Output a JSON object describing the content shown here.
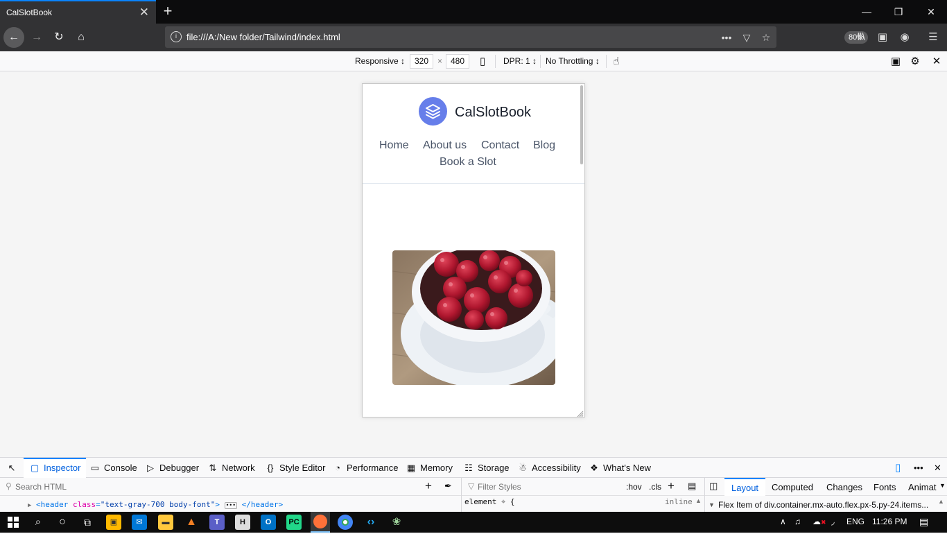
{
  "browser": {
    "tab_title": "CalSlotBook",
    "tab_close": "✕",
    "new_tab": "+",
    "url": "file:///A:/New folder/Tailwind/index.html",
    "zoom": "80%"
  },
  "rdm": {
    "device": "Responsive",
    "width": "320",
    "times": "×",
    "height": "480",
    "dpr": "DPR: 1",
    "throttling": "No Throttling"
  },
  "site": {
    "brand": "CalSlotBook",
    "nav": [
      "Home",
      "About us",
      "Contact",
      "Blog",
      "Book a Slot"
    ],
    "hero_image": "raspberries-in-white-cup"
  },
  "devtools": {
    "tabs": [
      "Inspector",
      "Console",
      "Debugger",
      "Network",
      "Style Editor",
      "Performance",
      "Memory",
      "Storage",
      "Accessibility",
      "What's New"
    ],
    "search_html_placeholder": "Search HTML",
    "filter_styles_placeholder": "Filter Styles",
    "hov": ":hov",
    "cls": ".cls",
    "side_tabs": [
      "Layout",
      "Computed",
      "Changes",
      "Fonts",
      "Animat"
    ],
    "markup_line": {
      "open": "<header",
      "attr_name": "class",
      "attr_value": "\"text-gray-700 body-font\"",
      "close": "</header>"
    },
    "rule_selector": "element",
    "rule_brace": "{",
    "rule_source": "inline",
    "flex_item_text": "Flex Item of div.container.mx-auto.flex.px-5.py-24.items..."
  },
  "taskbar": {
    "lang": "ENG",
    "time": "11:26 PM"
  },
  "colors": {
    "accent": "#0a84ff",
    "logo_bg": "#667eea",
    "chrome_dark": "#323234"
  }
}
